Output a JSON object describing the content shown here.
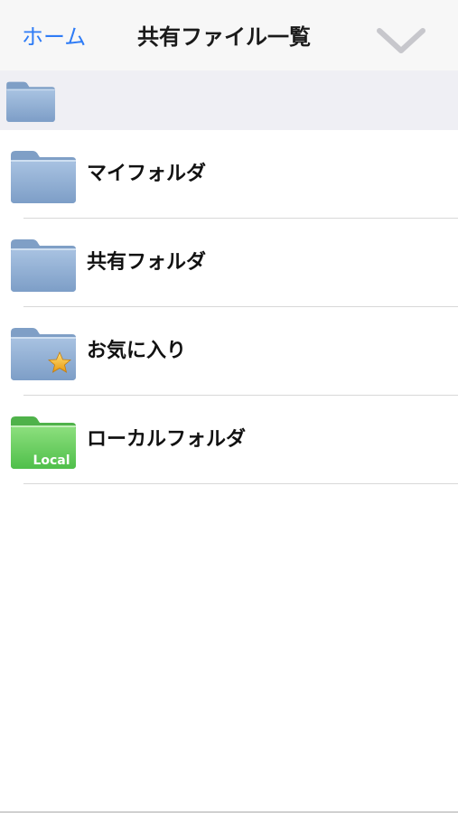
{
  "nav": {
    "back_label": "ホーム",
    "title": "共有ファイル一覧",
    "chevron_icon": "chevron-down-icon"
  },
  "path": {
    "icon": "folder-icon"
  },
  "folders": [
    {
      "label": "マイフォルダ",
      "icon": "folder-icon"
    },
    {
      "label": "共有フォルダ",
      "icon": "folder-icon"
    },
    {
      "label": "お気に入り",
      "icon": "favorite-folder-icon"
    },
    {
      "label": "ローカルフォルダ",
      "icon": "local-folder-icon",
      "badge": "Local"
    }
  ],
  "colors": {
    "accent": "#2f7cf6",
    "folder_blue": "#8fb0d6",
    "folder_green": "#6fcf6a",
    "star": "#f3b421"
  }
}
